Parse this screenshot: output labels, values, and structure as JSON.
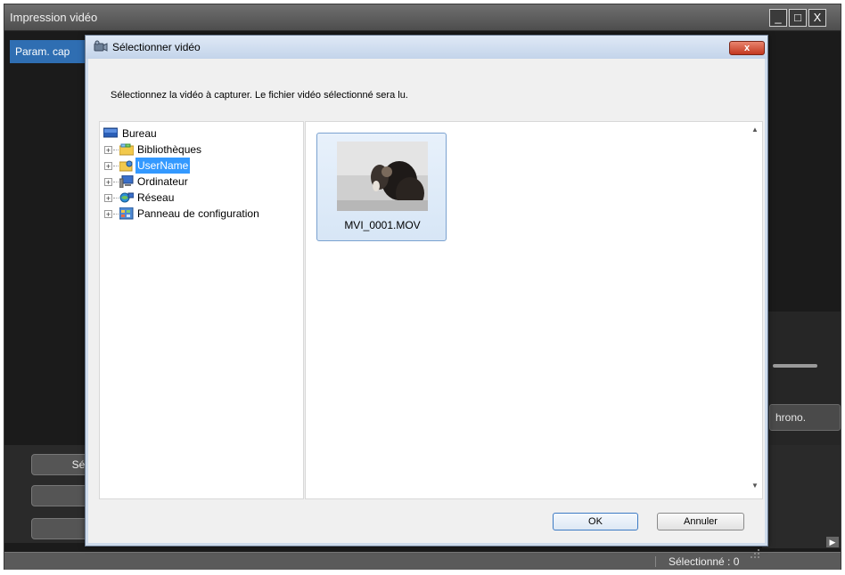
{
  "app": {
    "title": "Impression vidéo",
    "param_tab_label": "Param. cap",
    "chrono_button_label": "hrono.",
    "left_button_1_label": "Sél",
    "status_text": "Sélectionné : 0",
    "window_buttons": {
      "minimize": "_",
      "maximize": "□",
      "close": "X"
    }
  },
  "dialog": {
    "title": "Sélectionner vidéo",
    "close_label": "x",
    "instruction": "Sélectionnez la vidéo à capturer. Le fichier vidéo sélectionné sera lu.",
    "tree": {
      "root": {
        "label": "Bureau",
        "icon": "desktop-icon"
      },
      "items": [
        {
          "label": "Bibliothèques",
          "icon": "libraries-icon",
          "selected": false
        },
        {
          "label": "UserName",
          "icon": "user-folder-icon",
          "selected": true
        },
        {
          "label": "Ordinateur",
          "icon": "computer-icon",
          "selected": false
        },
        {
          "label": "Réseau",
          "icon": "network-icon",
          "selected": false
        },
        {
          "label": "Panneau de configuration",
          "icon": "control-panel-icon",
          "selected": false
        }
      ]
    },
    "files": [
      {
        "name": "MVI_0001.MOV",
        "icon": "video-thumbnail"
      }
    ],
    "ok_label": "OK",
    "cancel_label": "Annuler"
  },
  "colors": {
    "app_background": "#1b1b1b",
    "tab_accent": "#2f6eb2",
    "selection": "#3399ff"
  }
}
